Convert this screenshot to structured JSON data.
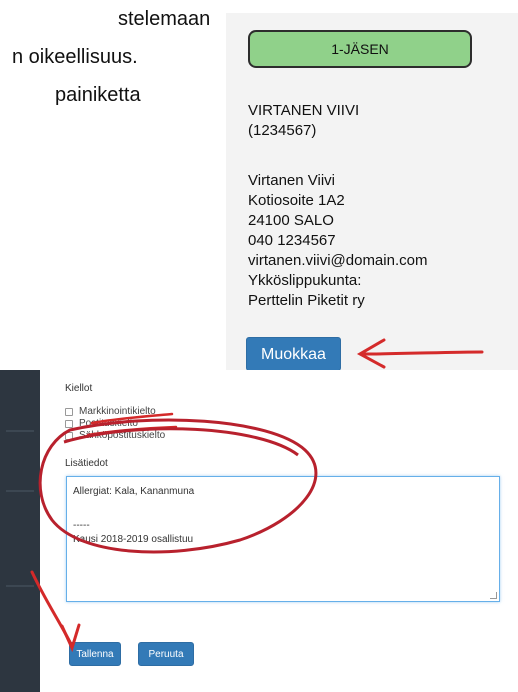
{
  "document_text": {
    "lines": [
      "stelemaan",
      "n oikeellisuus.",
      "painiketta"
    ]
  },
  "member_card": {
    "badge": "1-JÄSEN",
    "name_line1": "VIRTANEN VIIVI",
    "name_line2": "(1234567)",
    "details": [
      "Virtanen Viivi",
      "Kotiosoite 1A2",
      "24100 SALO",
      "040 1234567",
      "virtanen.viivi@domain.com",
      "Ykköslippukunta:",
      "Perttelin Piketit ry"
    ],
    "edit_button": "Muokkaa"
  },
  "form": {
    "prohibitions_label": "Kiellot",
    "checkboxes": [
      "Markkinointikielto",
      "Postituskielto",
      "Sähköpostituskielto"
    ],
    "additional_info_label": "Lisätiedot",
    "textarea_lines": [
      "Allergiat: Kala, Kananmuna",
      "",
      "-----",
      "Kausi 2018-2019 osallistuu"
    ],
    "save_button": "Tallenna",
    "cancel_button": "Peruuta"
  },
  "annotation_color": "#d42a2a"
}
